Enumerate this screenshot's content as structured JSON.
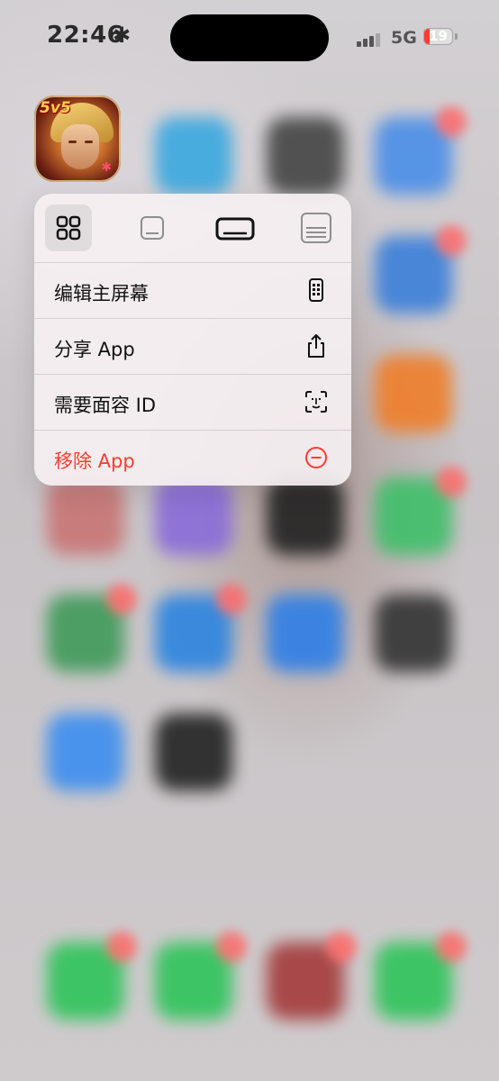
{
  "status_bar": {
    "time": "22:46",
    "time_glyph": "✱",
    "network": "5G",
    "battery_level": 19,
    "battery_text": "19",
    "signal_bars_active": 3,
    "signal_bars_total": 4
  },
  "focused_app": {
    "icon": "game-hero-icon",
    "badge_text": "5v5"
  },
  "context_menu": {
    "widget_sizes": [
      {
        "name": "app-icon-size",
        "selected": true
      },
      {
        "name": "small-widget-size",
        "selected": false
      },
      {
        "name": "medium-widget-size",
        "selected": false
      },
      {
        "name": "large-widget-size",
        "selected": false
      }
    ],
    "items": [
      {
        "label": "编辑主屏幕",
        "icon": "phone-screen-icon",
        "destructive": false
      },
      {
        "label": "分享 App",
        "icon": "share-icon",
        "destructive": false
      },
      {
        "label": "需要面容 ID",
        "icon": "face-id-icon",
        "destructive": false
      },
      {
        "label": "移除 App",
        "icon": "remove-circle-icon",
        "destructive": true
      }
    ]
  },
  "colors": {
    "destructive": "#ff3b30",
    "battery_low": "#ff3b30",
    "menu_background": "#f6f0f2"
  }
}
